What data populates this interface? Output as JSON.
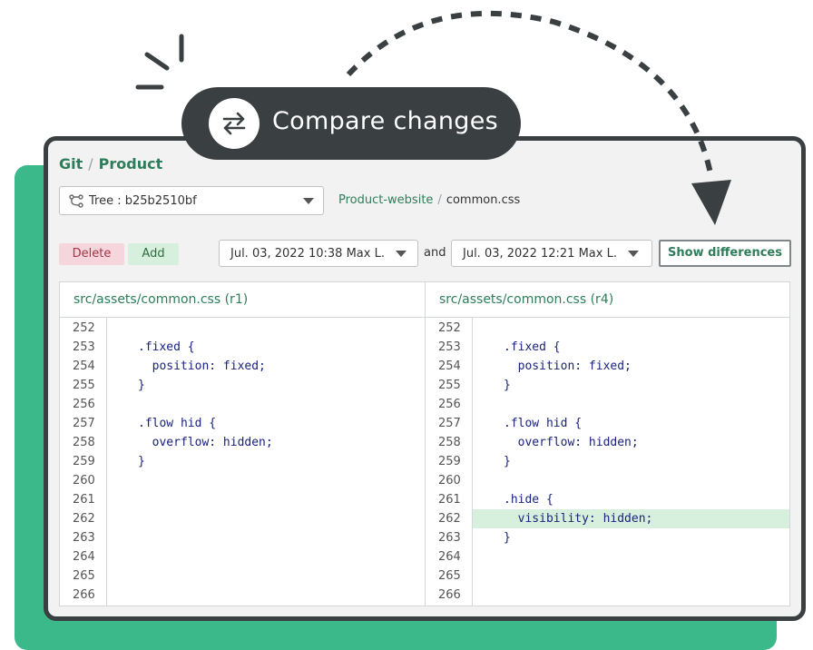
{
  "banner": {
    "title": "Compare changes",
    "icon": "swap-arrows-icon"
  },
  "breadcrumb": {
    "root": "Git",
    "separator": "/",
    "current": "Product"
  },
  "tree_select": {
    "value": "Tree : b25b2510bf",
    "icon": "branch-tree-icon"
  },
  "file_path": {
    "project": "Product-website",
    "separator": "/",
    "file": "common.css"
  },
  "toolbar": {
    "delete_label": "Delete",
    "add_label": "Add",
    "from_date": "Jul. 03, 2022 10:38 Max L.",
    "and_label": "and",
    "to_date": "Jul. 03, 2022 12:21 Max L.",
    "show_label": "Show differences"
  },
  "colors": {
    "brand_green": "#3bb98b",
    "added_line": "#d7f0dd",
    "frame_dark": "#3a3f42"
  },
  "diff": {
    "left": {
      "title": "src/assets/common.css (r1)",
      "lines": [
        {
          "n": "252",
          "code": ""
        },
        {
          "n": "253",
          "code": ".fixed {"
        },
        {
          "n": "254",
          "code": "  position: fixed;"
        },
        {
          "n": "255",
          "code": "}"
        },
        {
          "n": "256",
          "code": ""
        },
        {
          "n": "257",
          "code": ".flow hid {"
        },
        {
          "n": "258",
          "code": "  overflow: hidden;"
        },
        {
          "n": "259",
          "code": "}"
        },
        {
          "n": "260",
          "code": ""
        },
        {
          "n": "261",
          "code": ""
        },
        {
          "n": "262",
          "code": ""
        },
        {
          "n": "263",
          "code": ""
        },
        {
          "n": "264",
          "code": ""
        },
        {
          "n": "265",
          "code": ""
        },
        {
          "n": "266",
          "code": ""
        }
      ]
    },
    "right": {
      "title": "src/assets/common.css (r4)",
      "lines": [
        {
          "n": "252",
          "code": ""
        },
        {
          "n": "253",
          "code": ".fixed {"
        },
        {
          "n": "254",
          "code": "  position: fixed;"
        },
        {
          "n": "255",
          "code": "}"
        },
        {
          "n": "256",
          "code": ""
        },
        {
          "n": "257",
          "code": ".flow hid {"
        },
        {
          "n": "258",
          "code": "  overflow: hidden;"
        },
        {
          "n": "259",
          "code": "}"
        },
        {
          "n": "260",
          "code": ""
        },
        {
          "n": "261",
          "code": ".hide {"
        },
        {
          "n": "262",
          "code": "  visibility: hidden;",
          "added": true
        },
        {
          "n": "263",
          "code": "}"
        },
        {
          "n": "264",
          "code": ""
        },
        {
          "n": "265",
          "code": ""
        },
        {
          "n": "266",
          "code": ""
        }
      ]
    }
  }
}
